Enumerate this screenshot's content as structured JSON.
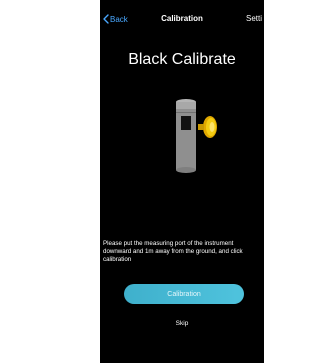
{
  "nav": {
    "back_label": "Back",
    "title": "Calibration",
    "settings_label": "Setti"
  },
  "main": {
    "heading": "Black Calibrate",
    "instructions": "Please put the measuring port of the instrument downward and 1m away from the ground, and click calibration",
    "calibration_button": "Calibration",
    "skip_label": "Skip"
  },
  "icons": {
    "back": "chevron-left-icon",
    "device": "instrument-illustration"
  },
  "colors": {
    "background": "#000000",
    "link": "#4aa8ff",
    "button": "#4fc3dd",
    "device_body": "#9a9a9a",
    "device_lens": "#f2c200"
  }
}
